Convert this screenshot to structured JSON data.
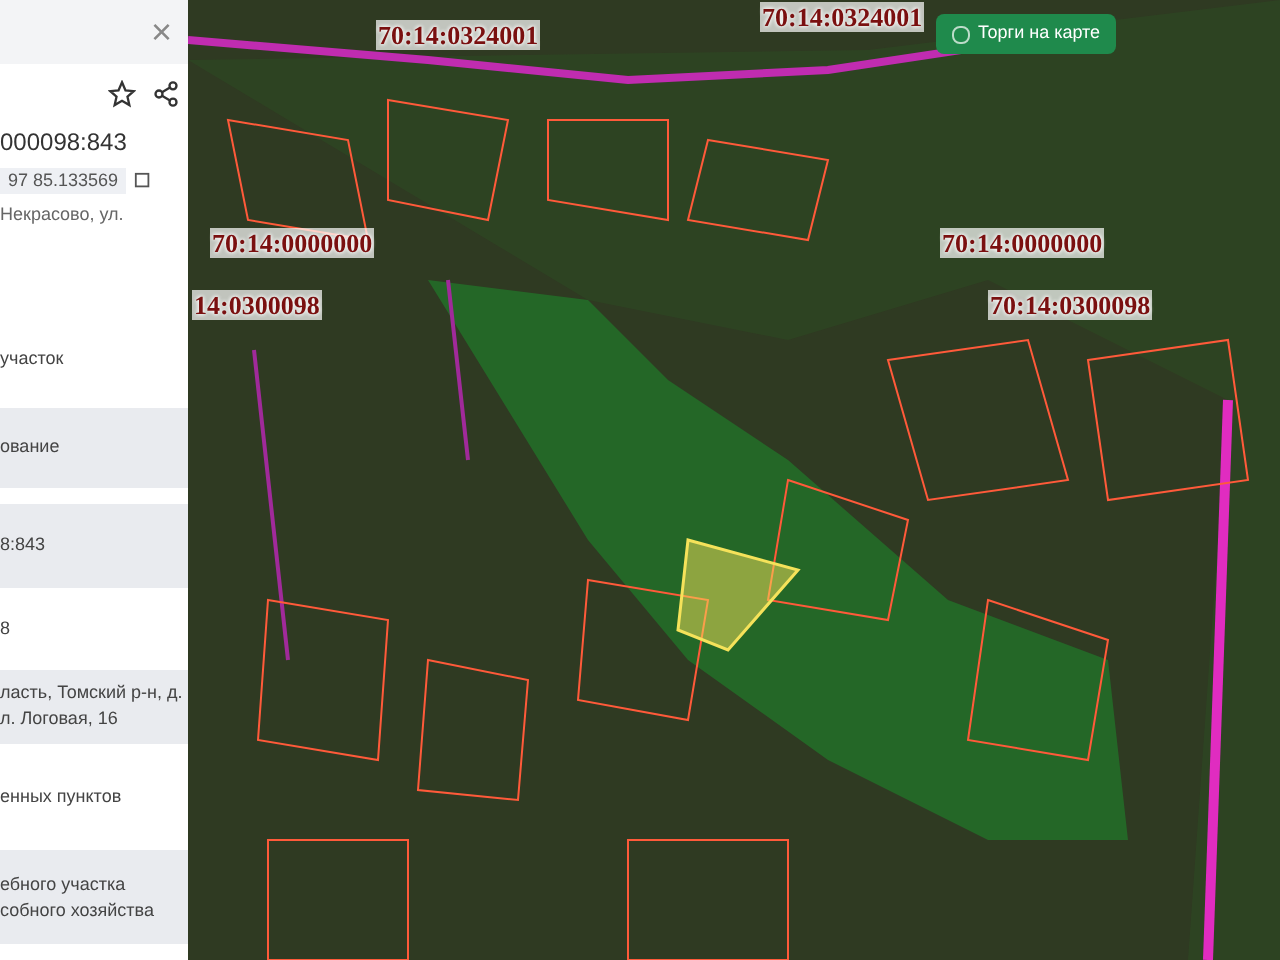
{
  "panel": {
    "close": "×",
    "cadastral": "000098:843",
    "coords": "97 85.133569",
    "address_short": "Некрасово, ул.",
    "rows": [
      {
        "text": "участок",
        "shaded": false
      },
      {
        "text": "ование",
        "shaded": true
      },
      {
        "text": "8:843",
        "shaded": true
      },
      {
        "text": "8",
        "shaded": false
      },
      {
        "text": "ласть, Томский р-н, д.\nл. Логовая, 16",
        "shaded": true
      },
      {
        "text": "енных пунктов",
        "shaded": false
      },
      {
        "text": "ебного участка\nсобного хозяйства",
        "shaded": true
      }
    ]
  },
  "map": {
    "toggle": {
      "label": "Торги на карте",
      "on": false
    },
    "labels": [
      {
        "text": "70:14:0324001"
      },
      {
        "text": "70:14:0324001"
      },
      {
        "text": "70:14:0000000"
      },
      {
        "text": "70:14:0000000"
      },
      {
        "text": "14:0300098"
      },
      {
        "text": "70:14:0300098"
      }
    ]
  }
}
